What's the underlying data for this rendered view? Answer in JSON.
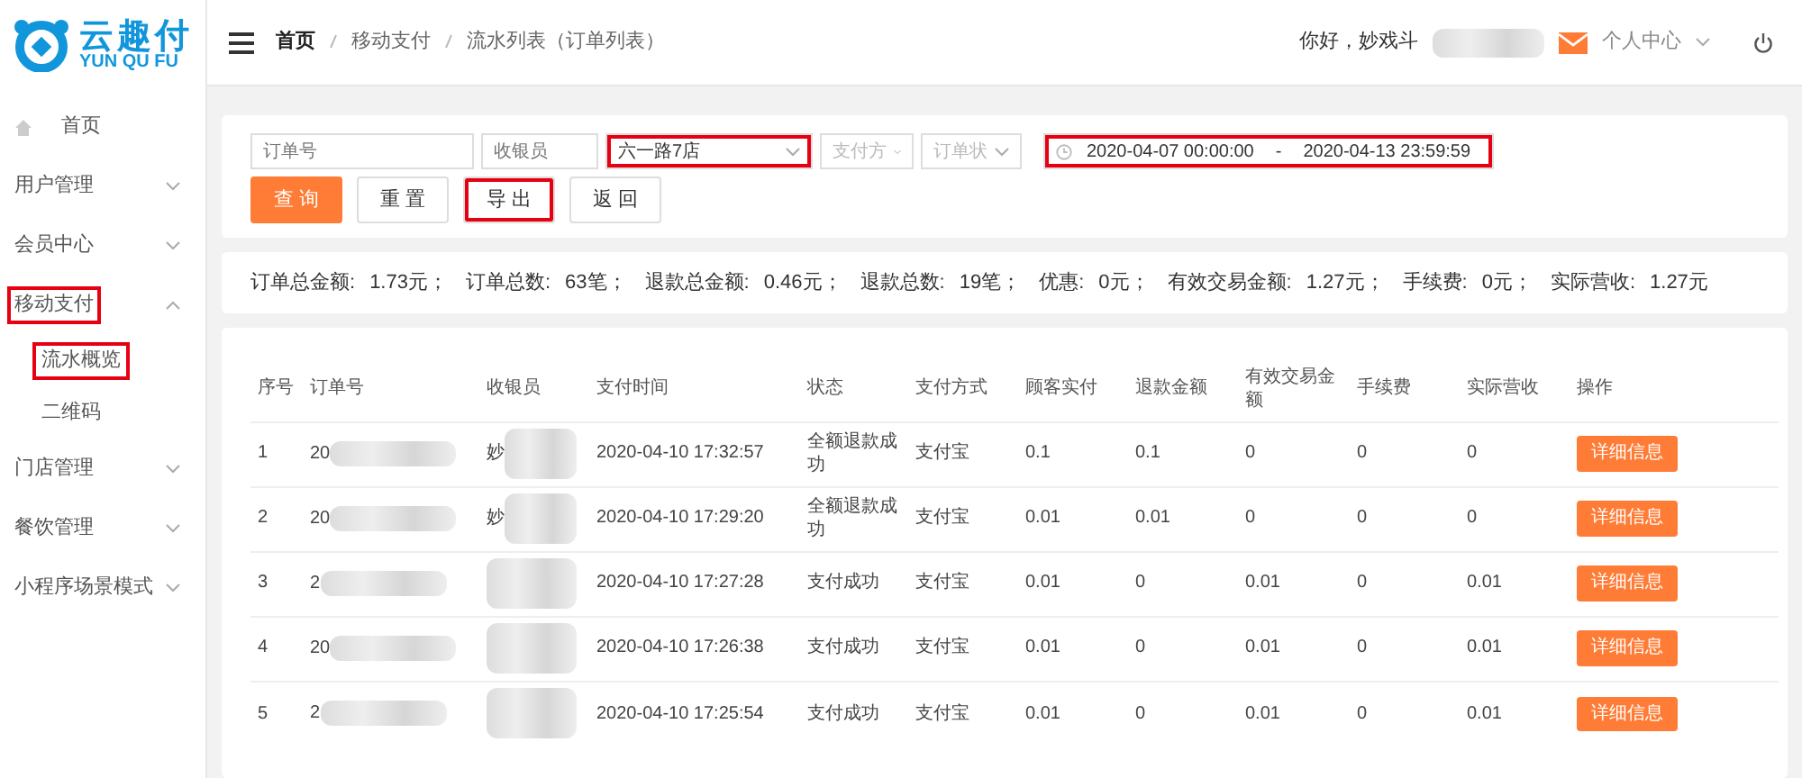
{
  "logo": {
    "title": "云趣付",
    "subtitle": "YUN QU FU"
  },
  "sidebar": {
    "items": [
      {
        "label": "首页",
        "kind": "home",
        "highlighted": false
      },
      {
        "label": "用户管理",
        "kind": "group",
        "expanded": false,
        "highlighted": false
      },
      {
        "label": "会员中心",
        "kind": "group",
        "expanded": false,
        "highlighted": false
      },
      {
        "label": "移动支付",
        "kind": "group",
        "expanded": true,
        "highlighted": true,
        "children": [
          {
            "label": "流水概览",
            "highlighted": true
          },
          {
            "label": "二维码",
            "highlighted": false
          }
        ]
      },
      {
        "label": "门店管理",
        "kind": "group",
        "expanded": false,
        "highlighted": false
      },
      {
        "label": "餐饮管理",
        "kind": "group",
        "expanded": false,
        "highlighted": false
      },
      {
        "label": "小程序场景模式",
        "kind": "group",
        "expanded": false,
        "highlighted": false
      }
    ]
  },
  "header": {
    "breadcrumb": [
      "首页",
      "移动支付",
      "流水列表（订单列表）"
    ],
    "greeting": "你好，妙戏斗",
    "greeting_redacted": true,
    "user_menu": "个人中心"
  },
  "filters": {
    "fields": [
      {
        "kind": "input",
        "placeholder": "订单号",
        "highlighted": false
      },
      {
        "kind": "input",
        "placeholder": "收银员",
        "highlighted": false
      },
      {
        "kind": "select",
        "value": "六一路7店",
        "highlighted": true
      },
      {
        "kind": "select",
        "placeholder": "支付方",
        "highlighted": false
      },
      {
        "kind": "select",
        "placeholder": "订单状",
        "highlighted": false
      },
      {
        "kind": "daterange",
        "start": "2020-04-07 00:00:00",
        "separator": "-",
        "end": "2020-04-13 23:59:59",
        "highlighted": true
      }
    ],
    "buttons": [
      {
        "label": "查 询",
        "kind": "primary",
        "highlighted": false
      },
      {
        "label": "重 置",
        "kind": "default",
        "highlighted": false
      },
      {
        "label": "导 出",
        "kind": "default",
        "highlighted": true
      },
      {
        "label": "返 回",
        "kind": "default",
        "highlighted": false
      }
    ]
  },
  "stats": [
    {
      "label": "订单总金额:",
      "value": "1.73元；"
    },
    {
      "label": "订单总数:",
      "value": "63笔；"
    },
    {
      "label": "退款总金额:",
      "value": "0.46元；"
    },
    {
      "label": "退款总数:",
      "value": "19笔；"
    },
    {
      "label": "优惠:",
      "value": "0元；"
    },
    {
      "label": "有效交易金额:",
      "value": "1.27元；"
    },
    {
      "label": "手续费:",
      "value": "0元；"
    },
    {
      "label": "实际营收:",
      "value": "1.27元"
    }
  ],
  "table": {
    "columns": [
      "序号",
      "订单号",
      "收银员",
      "支付时间",
      "状态",
      "支付方式",
      "顾客实付",
      "退款金额",
      "有效交易金额",
      "手续费",
      "实际营收",
      "操作"
    ],
    "rows": [
      {
        "no": "1",
        "order": "20",
        "cashier": "妙",
        "time": "2020-04-10 17:32:57",
        "status": "全额退款成功",
        "method": "支付宝",
        "paid": "0.1",
        "refund": "0.1",
        "effective": "0",
        "fee": "0",
        "revenue": "0",
        "action": "详细信息"
      },
      {
        "no": "2",
        "order": "20",
        "cashier": "妙",
        "time": "2020-04-10 17:29:20",
        "status": "全额退款成功",
        "method": "支付宝",
        "paid": "0.01",
        "refund": "0.01",
        "effective": "0",
        "fee": "0",
        "revenue": "0",
        "action": "详细信息"
      },
      {
        "no": "3",
        "order": "2",
        "time": "2020-04-10 17:27:28",
        "status": "支付成功",
        "method": "支付宝",
        "paid": "0.01",
        "refund": "0",
        "effective": "0.01",
        "fee": "0",
        "revenue": "0.01",
        "action": "详细信息"
      },
      {
        "no": "4",
        "order": "20",
        "time": "2020-04-10 17:26:38",
        "status": "支付成功",
        "method": "支付宝",
        "paid": "0.01",
        "refund": "0",
        "effective": "0.01",
        "fee": "0",
        "revenue": "0.01",
        "action": "详细信息"
      },
      {
        "no": "5",
        "order": "2",
        "time": "2020-04-10 17:25:54",
        "status": "支付成功",
        "method": "支付宝",
        "paid": "0.01",
        "refund": "0",
        "effective": "0.01",
        "fee": "0",
        "revenue": "0.01",
        "action": "详细信息"
      }
    ]
  }
}
